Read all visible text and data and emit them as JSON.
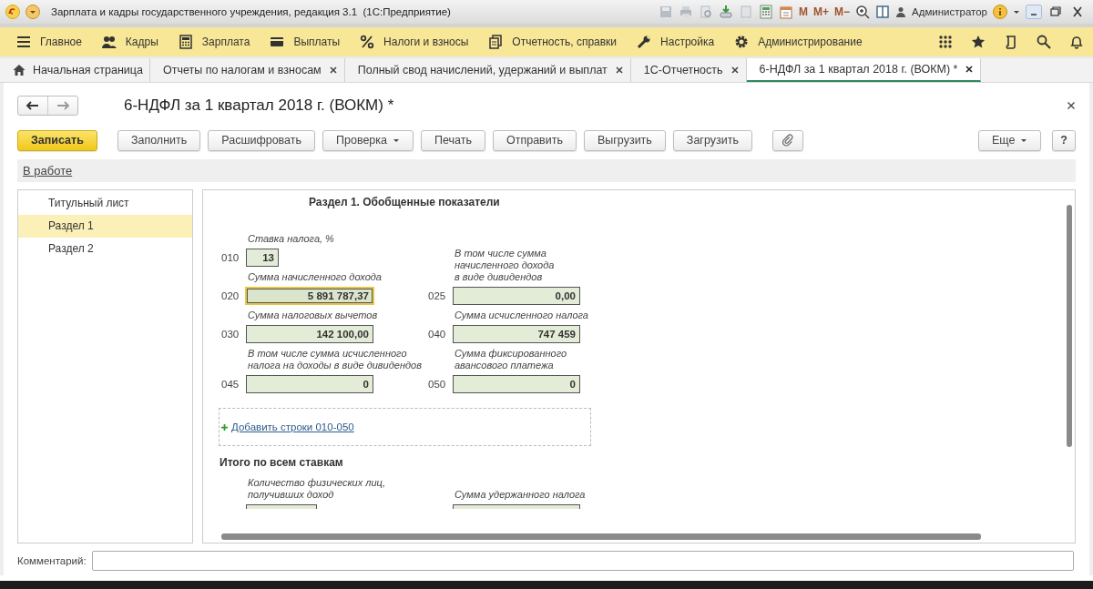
{
  "window": {
    "title": "Зарплата и кадры государственного учреждения, редакция 3.1  (1С:Предприятие)",
    "memory_buttons": [
      "M",
      "M+",
      "M−"
    ],
    "user": "Администратор"
  },
  "menu": [
    {
      "label": "Главное"
    },
    {
      "label": "Кадры"
    },
    {
      "label": "Зарплата"
    },
    {
      "label": "Выплаты"
    },
    {
      "label": "Налоги и взносы"
    },
    {
      "label": "Отчетность, справки"
    },
    {
      "label": "Настройка"
    },
    {
      "label": "Администрирование"
    }
  ],
  "tabs": [
    {
      "label": "Начальная страница",
      "closable": false,
      "selected": false
    },
    {
      "label": "Отчеты по налогам и взносам",
      "closable": true,
      "selected": false
    },
    {
      "label": "Полный свод начислений, удержаний и выплат",
      "closable": true,
      "selected": false
    },
    {
      "label": "1С-Отчетность",
      "closable": true,
      "selected": false
    },
    {
      "label": "6-НДФЛ за 1 квартал 2018 г. (ВОКМ) *",
      "closable": true,
      "selected": true
    }
  ],
  "form": {
    "title": "6-НДФЛ за 1 квартал 2018 г. (ВОКМ) *",
    "buttons": [
      {
        "label": "Записать",
        "kind": "primary"
      },
      {
        "label": "Заполнить",
        "kind": "plain"
      },
      {
        "label": "Расшифровать",
        "kind": "plain"
      },
      {
        "label": "Проверка",
        "kind": "dropdown"
      },
      {
        "label": "Печать",
        "kind": "plain"
      },
      {
        "label": "Отправить",
        "kind": "plain"
      },
      {
        "label": "Выгрузить",
        "kind": "plain"
      },
      {
        "label": "Загрузить",
        "kind": "plain"
      },
      {
        "kind": "attach"
      }
    ],
    "more": "Еще",
    "help": "?",
    "status_link": "В работе"
  },
  "nav": [
    {
      "label": "Титульный лист",
      "selected": false
    },
    {
      "label": "Раздел 1",
      "selected": true
    },
    {
      "label": "Раздел 2",
      "selected": false
    }
  ],
  "section": {
    "title": "Раздел 1. Обобщенные показатели",
    "rows": [
      {
        "left": {
          "code": "010",
          "label": "Ставка налога, %",
          "value": "13",
          "focused": false
        }
      },
      {
        "left": {
          "code": "020",
          "label": "Сумма начисленного дохода",
          "value": "5 891 787,37",
          "focused": true
        },
        "right": {
          "code": "025",
          "label": "В том числе сумма\nначисленного дохода\nв виде дивидендов",
          "value": "0,00",
          "focused": false
        }
      },
      {
        "left": {
          "code": "030",
          "label": "Сумма налоговых вычетов",
          "value": "142 100,00",
          "focused": false
        },
        "right": {
          "code": "040",
          "label": "Сумма исчисленного налога",
          "value": "747 459",
          "focused": false
        }
      },
      {
        "left": {
          "code": "045",
          "label": "В том числе сумма исчисленного\nналога на доходы в виде дивидендов",
          "value": "0",
          "focused": false
        },
        "right": {
          "code": "050",
          "label": "Сумма фиксированного\nавансового платежа",
          "value": "0",
          "focused": false
        }
      }
    ],
    "add_link": "Добавить строки 010-050",
    "totals_title": "Итого по всем ставкам",
    "totals_labels": [
      "Количество физических лиц,\nполучивших доход",
      "Сумма удержанного налога"
    ]
  },
  "comment": {
    "label": "Комментарий:"
  }
}
